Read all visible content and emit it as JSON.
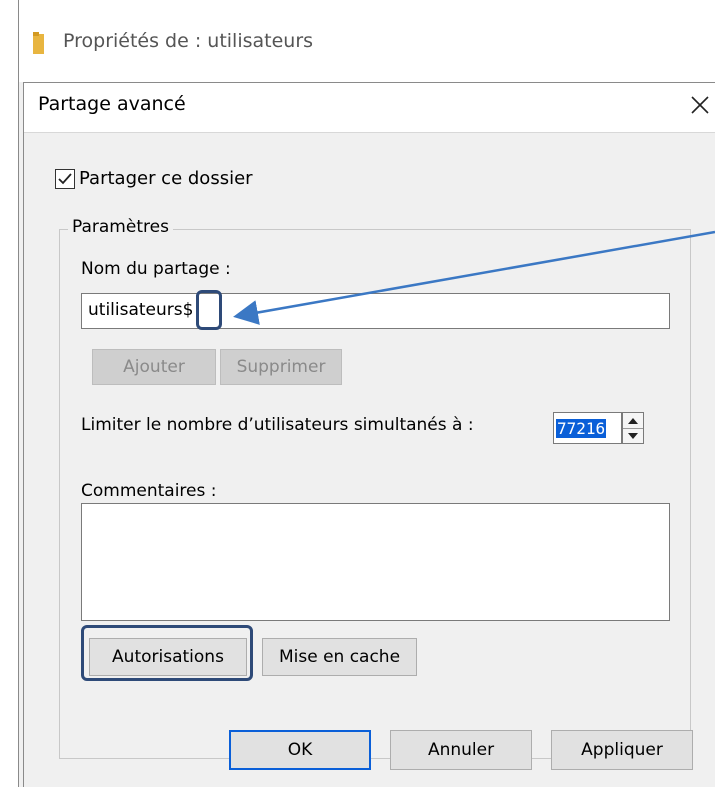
{
  "outer_window": {
    "title": "Propriétés de : utilisateurs"
  },
  "dialog": {
    "title": "Partage avancé",
    "share_checkbox": {
      "label": "Partager ce dossier",
      "checked": true
    },
    "settings_group": {
      "legend": "Paramètres",
      "share_name_label": "Nom du partage :",
      "share_name_value": "utilisateurs$",
      "add_button": "Ajouter",
      "remove_button": "Supprimer",
      "limit_label": "Limiter le nombre d’utilisateurs simultanés à :",
      "limit_value": "77216",
      "comments_label": "Commentaires :",
      "comments_value": "",
      "permissions_button": "Autorisations",
      "caching_button": "Mise en cache"
    },
    "footer": {
      "ok_button": "OK",
      "cancel_button": "Annuler",
      "apply_button": "Appliquer"
    }
  },
  "colors": {
    "callout": "#2e4a78",
    "arrow": "#3b78c4",
    "selection": "#0a5fd8",
    "folder": "#e8b540"
  }
}
